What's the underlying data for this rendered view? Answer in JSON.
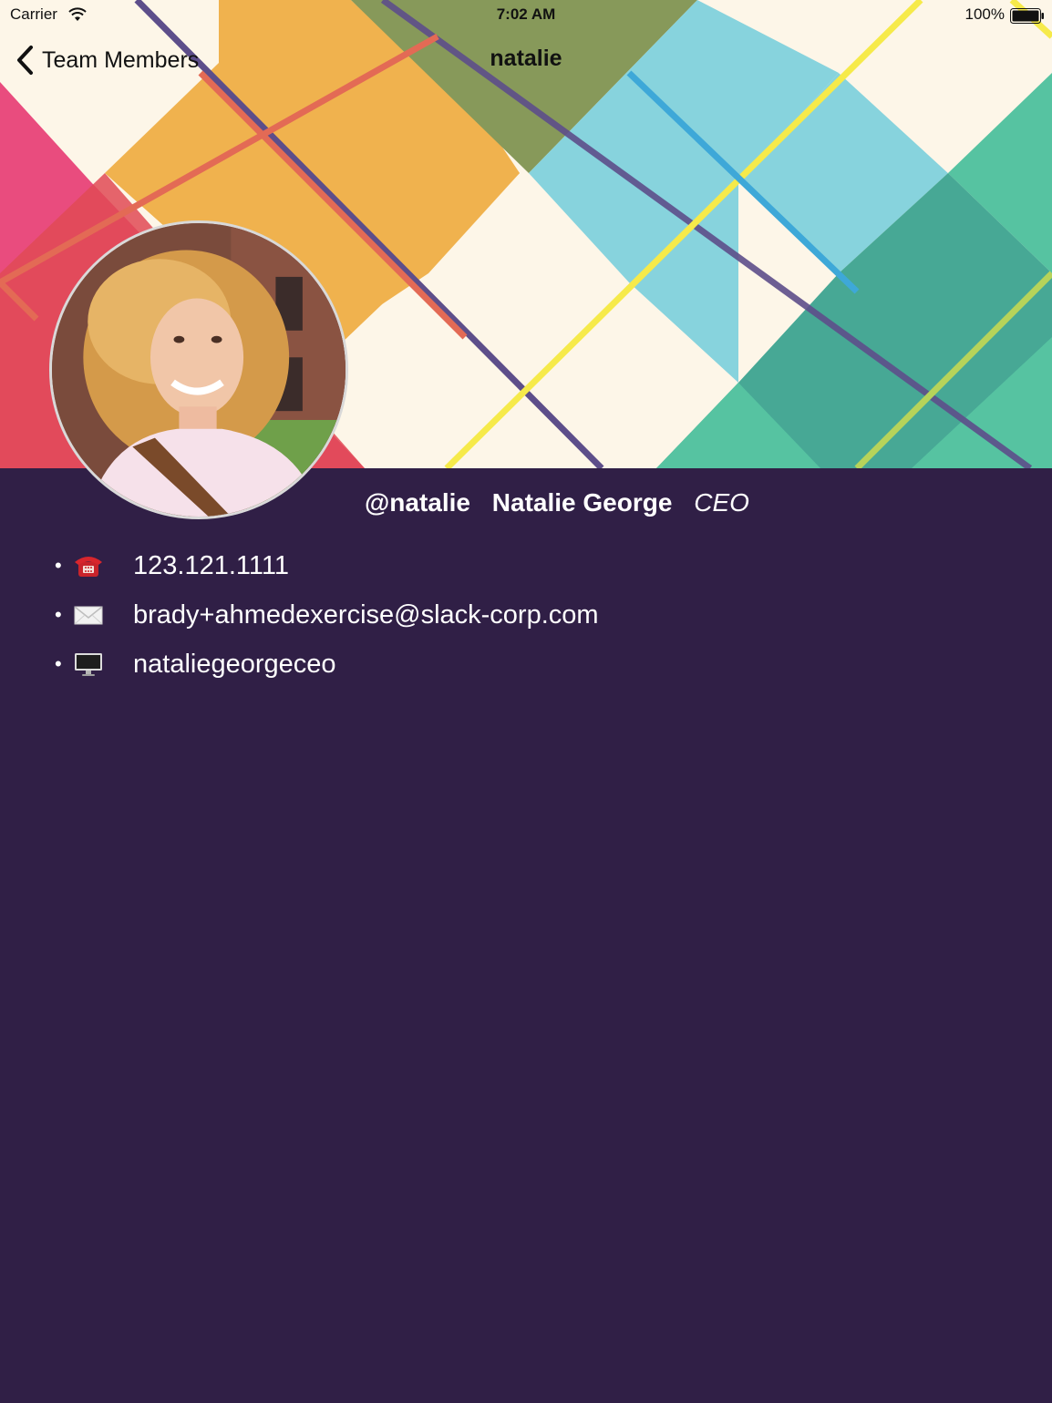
{
  "status_bar": {
    "carrier": "Carrier",
    "time": "7:02 AM",
    "battery": "100%"
  },
  "nav": {
    "back_label": "Team Members",
    "title": "natalie"
  },
  "profile": {
    "handle": "@natalie",
    "full_name": "Natalie George",
    "role": "CEO"
  },
  "contacts": [
    {
      "icon": "telephone-icon",
      "value": "123.121.1111"
    },
    {
      "icon": "envelope-icon",
      "value": "brady+ahmedexercise@slack-corp.com"
    },
    {
      "icon": "computer-monitor-icon",
      "value": "nataliegeorgeceo"
    }
  ],
  "colors": {
    "background": "#301f46",
    "text": "#ffffff",
    "plaid_cream": "#fdf6e8",
    "plaid_orange": "#f0b24e",
    "plaid_olive": "#87995a",
    "plaid_cyan": "#87d3dd",
    "plaid_teal": "#56c3a1",
    "plaid_dark_teal": "#47a895",
    "plaid_pink": "#e94c7e"
  }
}
